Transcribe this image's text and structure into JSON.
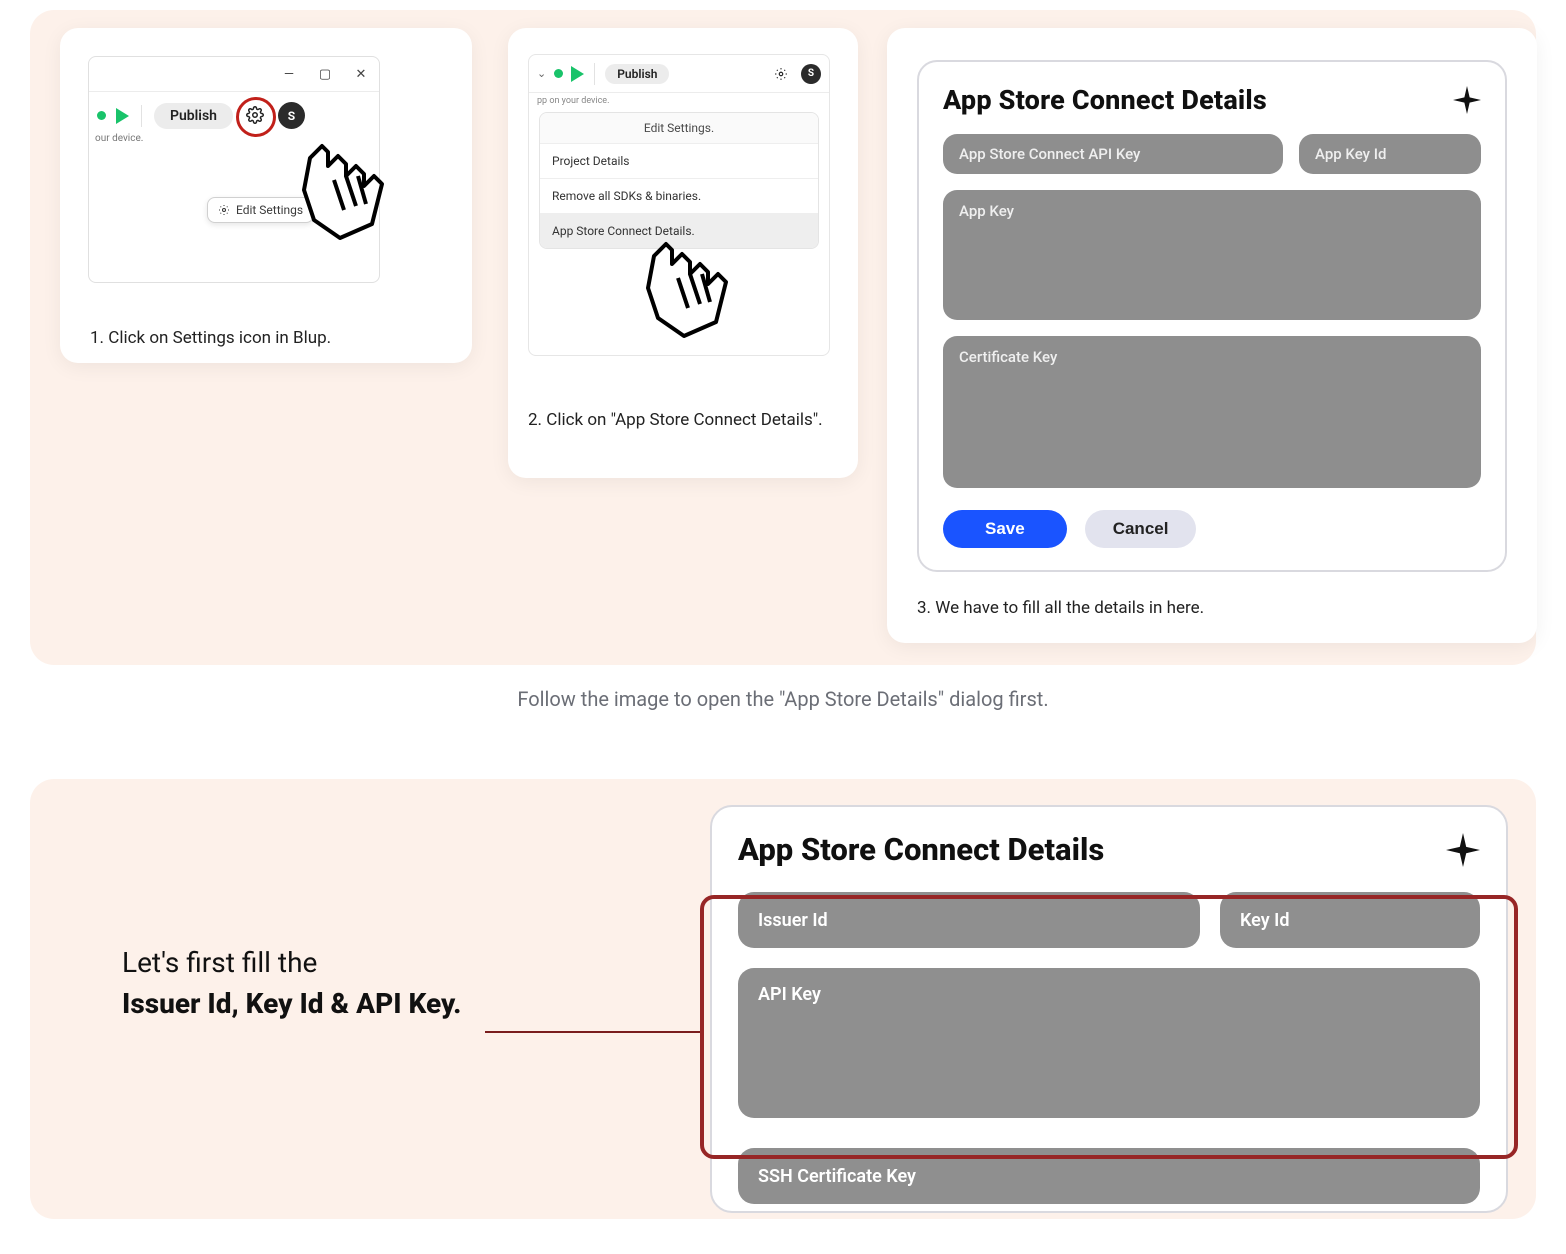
{
  "steps": {
    "step1": {
      "caption": "1. Click on Settings icon in Blup.",
      "window": {
        "publish_label": "Publish",
        "device_hint": "our device.",
        "avatar_initial": "S",
        "edit_settings_label": "Edit Settings"
      }
    },
    "step2": {
      "caption": "2. Click on \"App Store Connect Details\".",
      "window": {
        "publish_label": "Publish",
        "device_hint": "pp on your device.",
        "dropdown_header": "Edit Settings.",
        "items": [
          "Project Details",
          "Remove all SDKs & binaries.",
          "App Store Connect Details."
        ],
        "avatar_initial": "S"
      }
    },
    "step3": {
      "caption": "3. We have to fill all the details in here.",
      "dialog": {
        "title": "App Store Connect Details",
        "fields": {
          "api_key": "App Store Connect API Key",
          "app_key_id": "App Key Id",
          "app_key": "App Key",
          "certificate_key": "Certificate Key"
        },
        "actions": {
          "save": "Save",
          "cancel": "Cancel"
        }
      }
    }
  },
  "subcaption": "Follow the image to open the \"App Store Details\" dialog first.",
  "bottom": {
    "lead_in": "Let's first fill the",
    "bold_line": "Issuer Id, Key Id & API Key.",
    "dialog": {
      "title": "App Store Connect Details",
      "fields": {
        "issuer_id": "Issuer Id",
        "key_id": "Key Id",
        "api_key": "API Key",
        "ssh_cert": "SSH Certificate Key"
      }
    }
  },
  "colors": {
    "accent_blue": "#1a54ff",
    "highlight_red": "#972626",
    "panel_pink": "#fdf1ea"
  }
}
